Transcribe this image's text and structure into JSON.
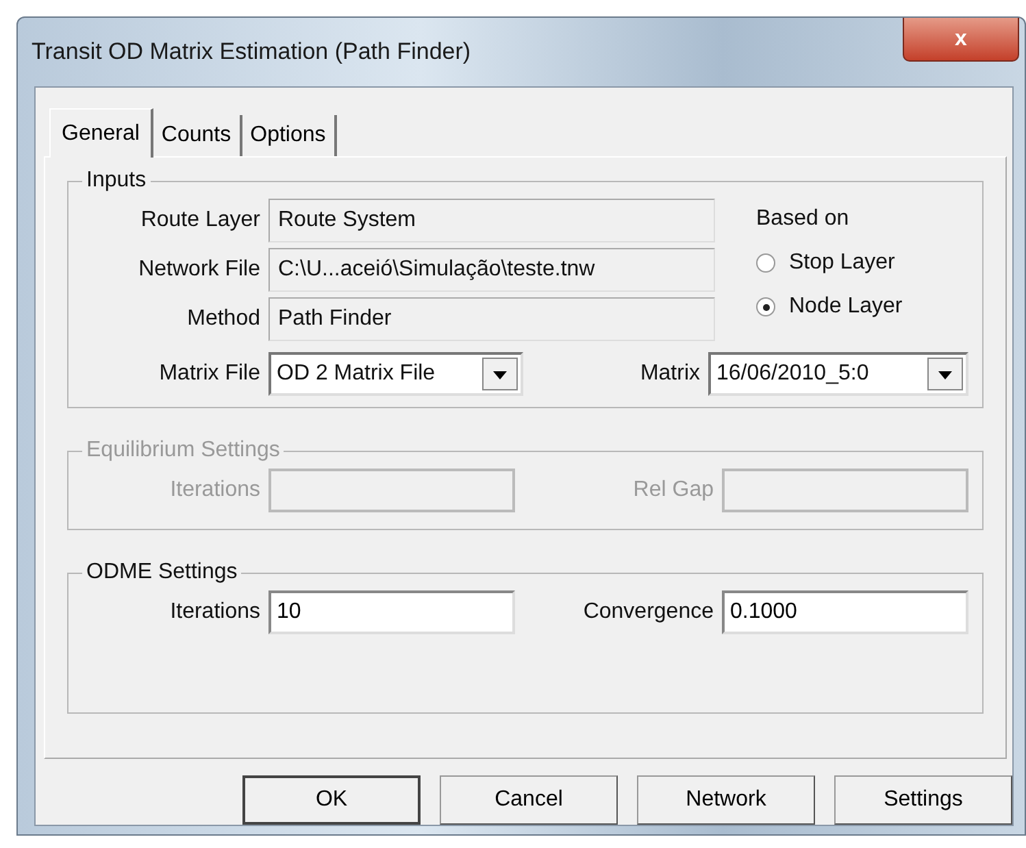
{
  "window": {
    "title": "Transit OD Matrix Estimation (Path Finder)",
    "close": "x"
  },
  "tabs": [
    {
      "label": "General",
      "selected": true
    },
    {
      "label": "Counts",
      "selected": false
    },
    {
      "label": "Options",
      "selected": false
    }
  ],
  "inputs": {
    "title": "Inputs",
    "fields": [
      {
        "label": "Route Layer",
        "value": "Route System"
      },
      {
        "label": "Network File",
        "value": "C:\\U...aceió\\Simulação\\teste.tnw"
      },
      {
        "label": "Method",
        "value": "Path Finder"
      }
    ],
    "based_on": {
      "title": "Based on",
      "options": [
        {
          "label": "Stop Layer",
          "selected": false
        },
        {
          "label": "Node Layer",
          "selected": true
        }
      ]
    },
    "matrix_file": {
      "label": "Matrix File",
      "value": "OD 2 Matrix File"
    },
    "matrix": {
      "label": "Matrix",
      "value": "16/06/2010_5:0"
    }
  },
  "equilibrium": {
    "title": "Equilibrium Settings",
    "disabled": true,
    "fields": [
      {
        "label": "Iterations"
      },
      {
        "label": "Rel Gap"
      }
    ]
  },
  "odme": {
    "title": "ODME Settings",
    "disabled": false,
    "fields": [
      {
        "label": "Iterations",
        "value": "10"
      },
      {
        "label": "Convergence",
        "value": "0.1000"
      }
    ]
  },
  "buttons": [
    {
      "label": "OK",
      "default": true
    },
    {
      "label": "Cancel",
      "default": false
    },
    {
      "label": "Network",
      "default": false
    },
    {
      "label": "Settings",
      "default": false
    }
  ]
}
